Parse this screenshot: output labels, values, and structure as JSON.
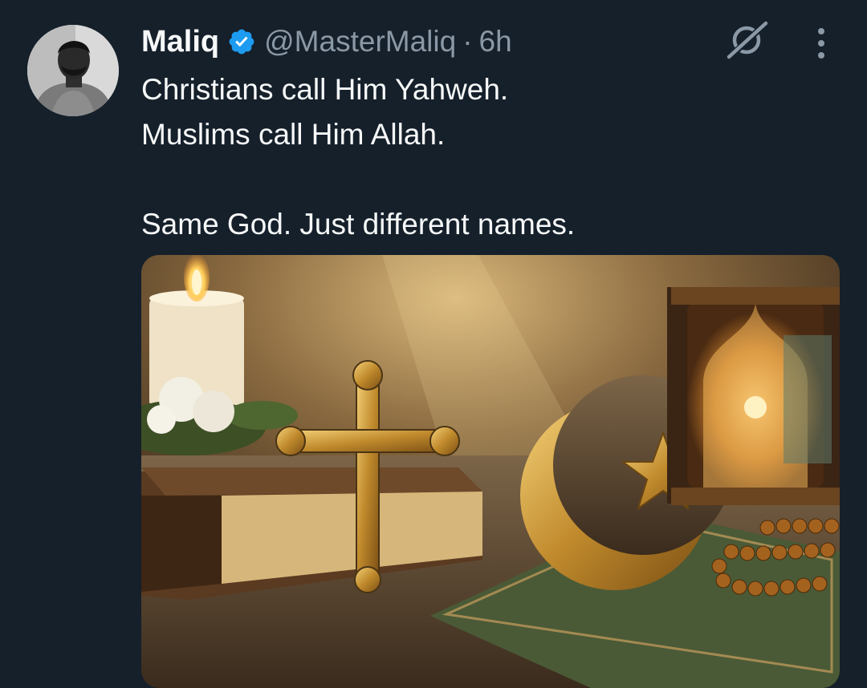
{
  "tweet": {
    "author": {
      "name": "Maliq",
      "handle": "@MasterMaliq",
      "verified": true,
      "avatar_icon": "avatar"
    },
    "separator": "·",
    "time": "6h",
    "text_lines": [
      "Christians call Him Yahweh.",
      "Muslims call Him Allah.",
      "Same God. Just different names."
    ],
    "actions": {
      "grok_icon": "grok-icon",
      "more_icon": "more-vertical-icon"
    },
    "media_icon": "interfaith-photo"
  },
  "colors": {
    "background": "#15202b",
    "text_primary": "#f7f9f9",
    "text_secondary": "#8b98a5",
    "verified_blue": "#1d9bf0"
  }
}
